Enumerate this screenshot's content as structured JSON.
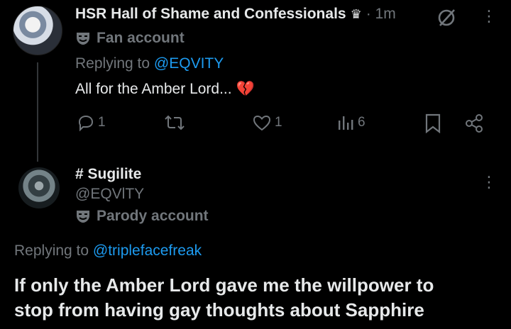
{
  "tweet1": {
    "display_name": "HSR Hall of Shame and Confessionals",
    "crown_glyph": "♛",
    "time": "· 1m",
    "account_label": "Fan account",
    "replying_prefix": "Replying to",
    "replying_handle": "@EQVITY",
    "text": "All for the Amber Lord...",
    "emoji": "💔",
    "reply_count": "1",
    "retweet_count": "",
    "like_count": "1",
    "view_count": "6"
  },
  "tweet2": {
    "display_name": "# Sugilite",
    "handle": "@EQVlTY",
    "account_label": "Parody account",
    "replying_prefix": "Replying to",
    "replying_handle": "@triplefacefreak",
    "text_line1": "If only the Amber Lord gave me the willpower to",
    "text_line2": "stop from having gay thoughts  about Sapphire"
  },
  "icons": [
    "mask-icon",
    "reply-icon",
    "retweet-icon",
    "like-icon",
    "views-icon",
    "bookmark-icon",
    "share-icon",
    "grok-icon",
    "more-icon"
  ],
  "colors": {
    "background": "#000000",
    "text": "#e7e9ea",
    "muted": "#71767b",
    "link": "#1d9bf0",
    "heart": "#f4212e"
  }
}
